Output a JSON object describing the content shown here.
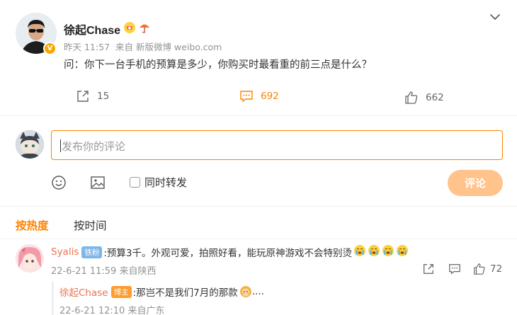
{
  "post": {
    "author": "徐起Chase",
    "time": "昨天 11:57",
    "source": "来自 新版微博 weibo.com",
    "text": "问：你下一台手机的预算是多少，你购买时最看重的前三点是什么？",
    "verified_badge": "V",
    "shares": "15",
    "comments": "692",
    "likes": "662"
  },
  "composer": {
    "placeholder": "发布你的评论",
    "forward_label": "同时转发",
    "submit_label": "评论"
  },
  "sort_tabs": {
    "hot": "按热度",
    "time": "按时间"
  },
  "comment": {
    "user": "Syalis",
    "tag": "铁粉",
    "text": ":预算3千。外观可爱，拍照好看，能玩原神游戏不会特别烫",
    "time": "22-6-21 11:59 来自陕西",
    "likes": "72",
    "emoji_count": 4
  },
  "reply": {
    "user": "徐起Chase",
    "tag": "博主",
    "text_before": ":那岂不是我们7月的那款",
    "text_after": "....",
    "time": "22-6-21 12:10 来自广东"
  },
  "colors": {
    "accent": "#ff8200",
    "username": "#eb7350",
    "muted": "#939393",
    "submit_disabled": "#ffc38b"
  }
}
